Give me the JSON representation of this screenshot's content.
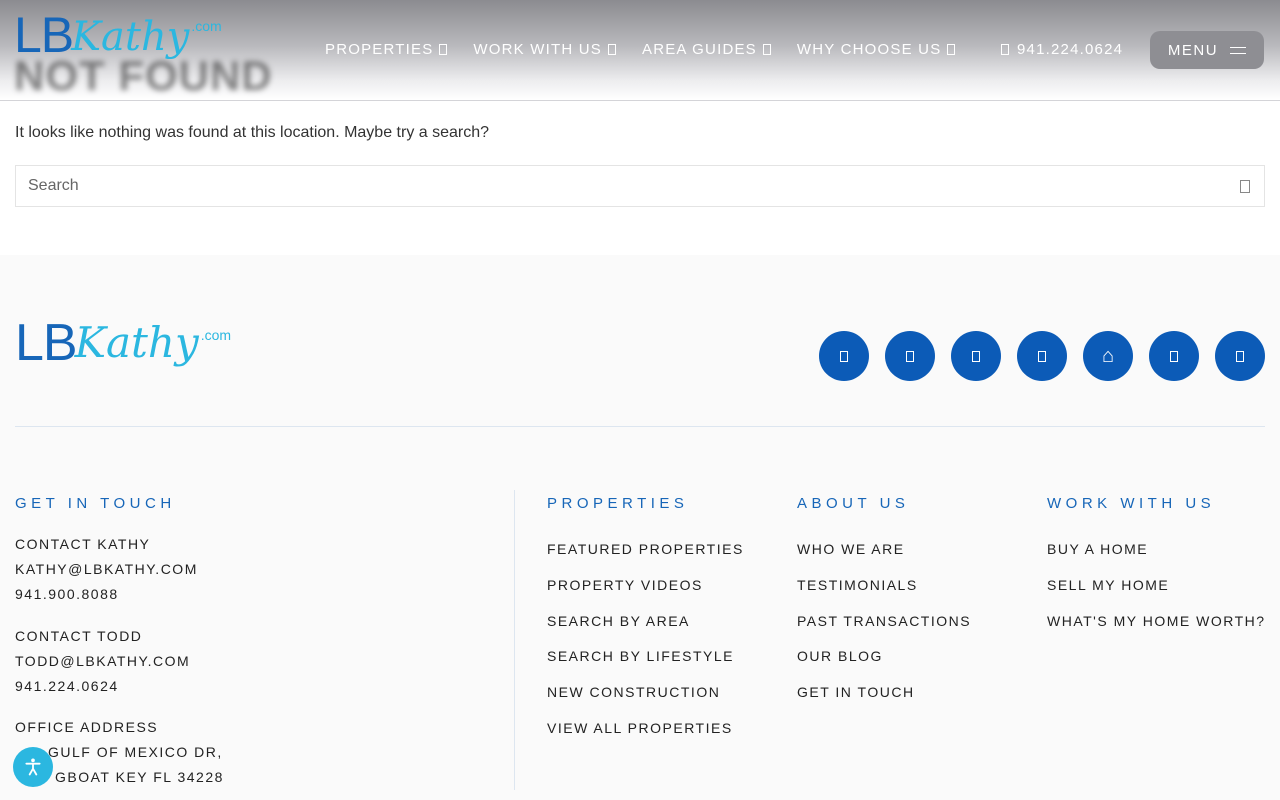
{
  "header": {
    "blurred_title": "NOT FOUND",
    "logo": {
      "lb": "LB",
      "kathy": "Kathy",
      "dotcom": ".com"
    },
    "nav": [
      {
        "label": "PROPERTIES"
      },
      {
        "label": "WORK WITH US"
      },
      {
        "label": "AREA GUIDES"
      },
      {
        "label": "WHY CHOOSE US"
      }
    ],
    "phone": "941.224.0624",
    "menu_label": "MENU"
  },
  "content": {
    "message": "It looks like nothing was found at this location. Maybe try a search?",
    "search_placeholder": "Search"
  },
  "footer": {
    "logo": {
      "lb": "LB",
      "kathy": "Kathy",
      "dotcom": ".com"
    },
    "socials": [
      "facebook-icon",
      "instagram-icon",
      "linkedin-icon",
      "youtube-icon",
      "zillow-icon",
      "twitter-icon",
      "pinterest-icon"
    ],
    "get_in_touch": {
      "title": "GET IN TOUCH",
      "lines": [
        "CONTACT KATHY",
        "KATHY@LBKATHY.COM",
        "941.900.8088",
        "CONTACT TODD",
        "TODD@LBKATHY.COM",
        "941.224.0624",
        "OFFICE ADDRESS",
        "GULF OF MEXICO DR,",
        "GBOAT KEY FL 34228"
      ]
    },
    "properties": {
      "title": "PROPERTIES",
      "links": [
        "FEATURED PROPERTIES",
        "PROPERTY VIDEOS",
        "SEARCH BY AREA",
        "SEARCH BY LIFESTYLE",
        "NEW CONSTRUCTION",
        "VIEW ALL PROPERTIES"
      ]
    },
    "about": {
      "title": "ABOUT US",
      "links": [
        "WHO WE ARE",
        "TESTIMONIALS",
        "PAST TRANSACTIONS",
        "OUR BLOG",
        "GET IN TOUCH"
      ]
    },
    "work": {
      "title": "WORK WITH US",
      "links": [
        "BUY A HOME",
        "SELL MY HOME",
        "WHAT'S MY HOME WORTH?"
      ]
    }
  },
  "colors": {
    "brand_blue": "#1766b8",
    "brand_cyan": "#2bb7e0",
    "social_blue": "#0c5bb7"
  }
}
